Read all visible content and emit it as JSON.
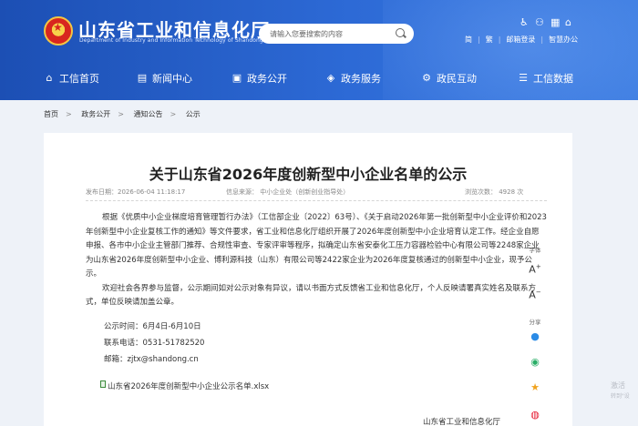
{
  "header": {
    "site_title": "山东省工业和信息化厅",
    "site_subtitle": "Department of Industry and Information Technology of Shandong Province",
    "search_placeholder": "请输入您要搜索的内容",
    "links": [
      "简",
      "繁",
      "邮箱登录",
      "智慧办公"
    ],
    "icons": [
      "accessibility-icon",
      "elder-icon",
      "sitemap-icon",
      "home-icon"
    ]
  },
  "nav": {
    "items": [
      {
        "label": "工信首页",
        "icon": "home-icon"
      },
      {
        "label": "新闻中心",
        "icon": "news-icon"
      },
      {
        "label": "政务公开",
        "icon": "government-icon"
      },
      {
        "label": "政务服务",
        "icon": "service-icon"
      },
      {
        "label": "政民互动",
        "icon": "interaction-icon"
      },
      {
        "label": "工信数据",
        "icon": "data-icon"
      }
    ]
  },
  "breadcrumb": [
    "首页",
    "政务公开",
    "通知公告",
    "公示"
  ],
  "article": {
    "title": "关于山东省2026年度创新型中小企业名单的公示",
    "publish_time": "发布日期：2026-06-04 11:18:17",
    "source": "信息来源：  中小企业处（创新创业指导处）",
    "views": "浏览次数：   4928      次",
    "paragraph1": "根据《优质中小企业梯度培育管理暂行办法》（工信部企业〔2022〕63号）、《关于启动2026年第一批创新型中小企业评价和2023年创新型中小企业复核工作的通知》等文件要求，省工业和信息化厅组织开展了2026年度创新型中小企业培育认定工作。经企业自愿申报、各市中小企业主管部门推荐、合规性审查、专家评审等程序，拟确定山东省安泰化工压力容器检验中心有限公司等2248家企业为山东省2026年度创新型中小企业、博利源科技（山东）有限公司等2422家企业为2026年度复核通过的创新型中小企业，现予公示。",
    "paragraph2": "欢迎社会各界参与监督，公示期间如对公示对象有异议，请以书面方式反馈省工业和信息化厅，个人反映请署真实姓名及联系方式，单位反映请加盖公章。",
    "period": "公示时间：6月4日-6月10日",
    "phone": "联系电话：0531-51782520",
    "email": "邮箱：zjtx@shandong.cn",
    "attachment": "山东省2026年度创新型中小企业公示名单.xlsx",
    "signature": "山东省工业和信息化厅"
  },
  "side_tools": {
    "font_label": "字体",
    "share_label": "分享"
  },
  "watermark": {
    "line1": "激活",
    "line2": "转到\"设"
  }
}
